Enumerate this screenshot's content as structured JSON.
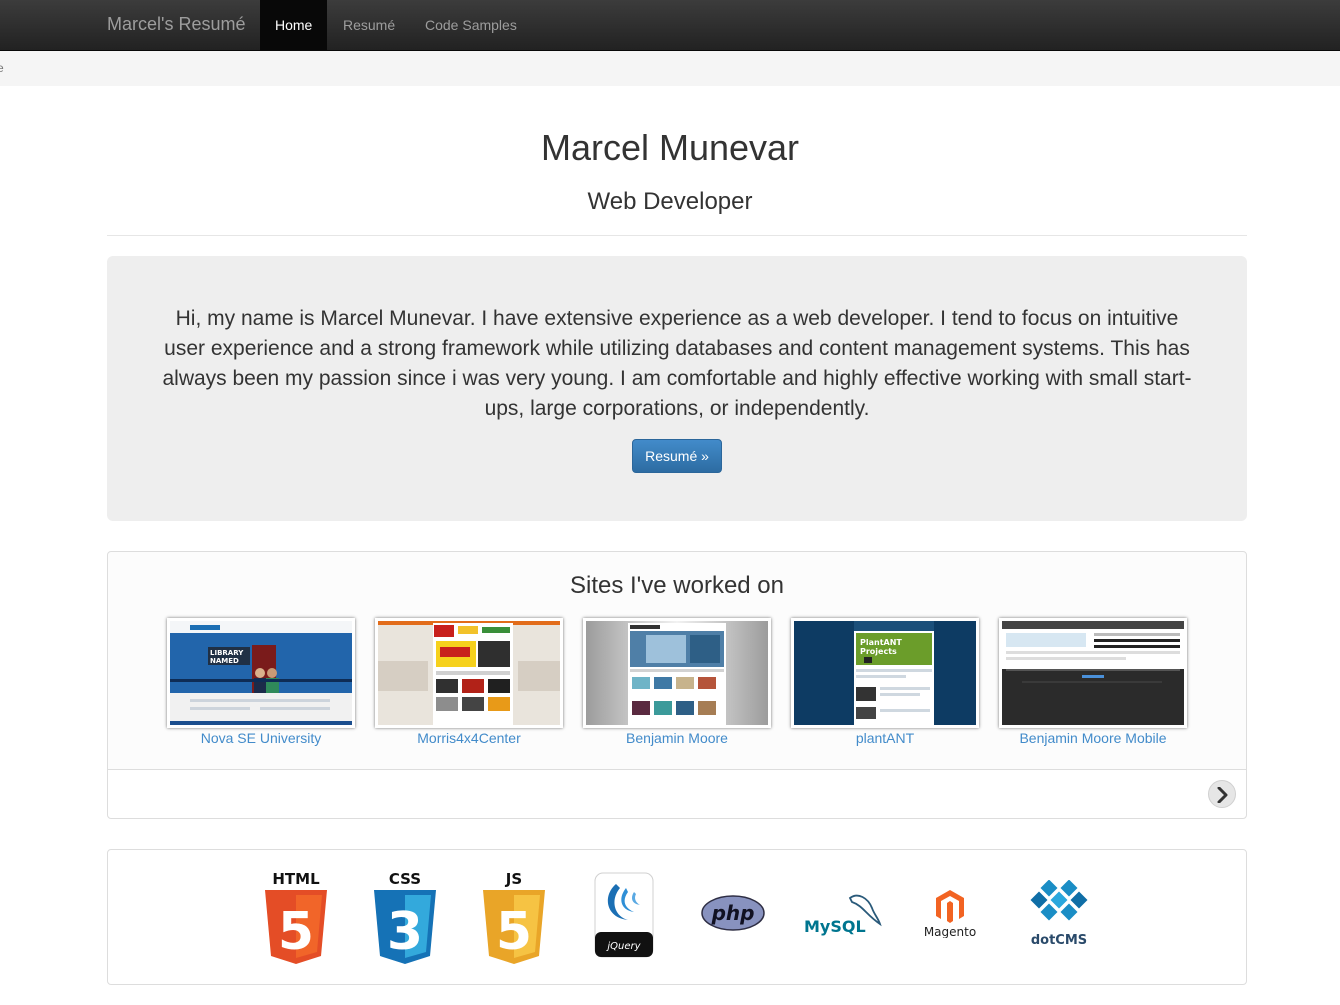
{
  "navbar": {
    "brand": "Marcel's Resumé",
    "items": [
      {
        "label": "Home",
        "active": true
      },
      {
        "label": "Resumé",
        "active": false
      },
      {
        "label": "Code Samples",
        "active": false
      }
    ]
  },
  "breadcrumb": {
    "text": "e"
  },
  "header": {
    "name": "Marcel Munevar",
    "role": "Web Developer"
  },
  "intro": {
    "text": "Hi, my name is Marcel Munevar. I have extensive experience as a web developer. I tend to focus on intuitive user experience and a strong framework while utilizing databases and content management systems. This has always been my passion since i was very young. I am comfortable and highly effective working with small start-ups, large corporations, or independently.",
    "button_label": "Resumé »"
  },
  "sites": {
    "title": "Sites I've worked on",
    "items": [
      {
        "label": "Nova SE University"
      },
      {
        "label": "Morris4x4Center"
      },
      {
        "label": "Benjamin Moore"
      },
      {
        "label": "plantANT"
      },
      {
        "label": "Benjamin Moore Mobile"
      }
    ],
    "next_icon": "chevron-right-icon"
  },
  "tech": {
    "html_label": "HTML",
    "html_num": "5",
    "css_label": "CSS",
    "css_num": "3",
    "js_label": "JS",
    "js_num": "5",
    "jquery_label": "jQuery",
    "php_label": "php",
    "mysql_label": "MySQL",
    "magento_label": "Magento",
    "dotcms_label": "dotCMS"
  },
  "colors": {
    "navbar": "#222222",
    "link": "#428bca",
    "primary_button": "#2d6ca2",
    "jumbotron": "#eeeeee",
    "html5": "#e44d26",
    "css3": "#1572b6",
    "js": "#f0a830"
  }
}
